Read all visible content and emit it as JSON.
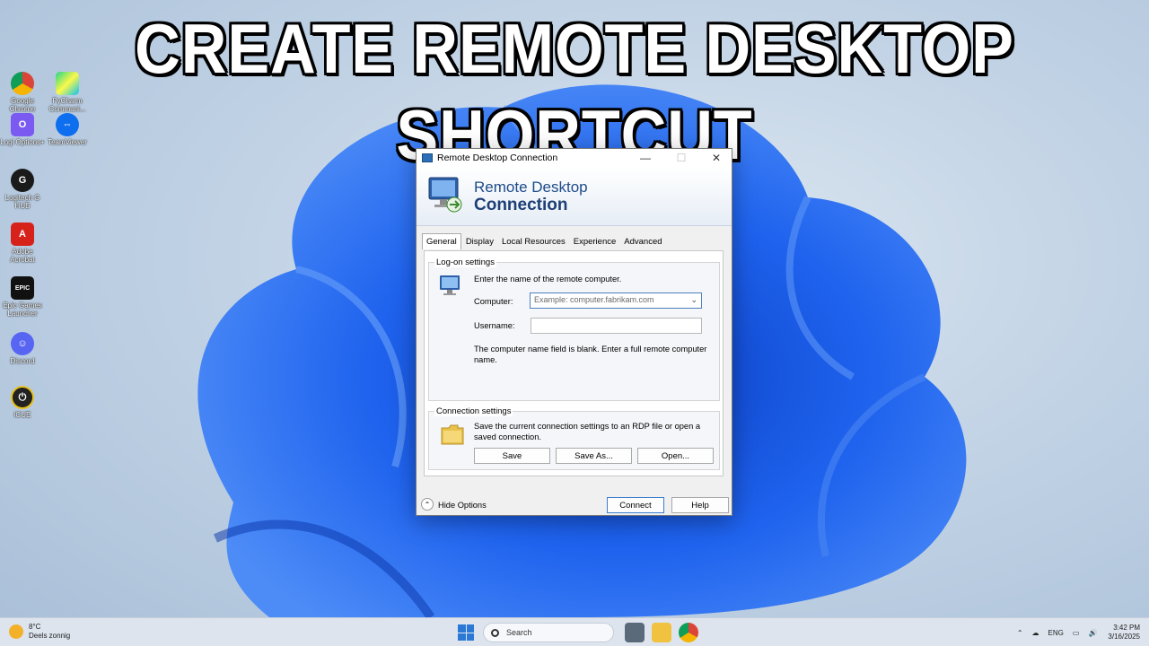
{
  "banner": {
    "title": "CREATE REMOTE DESKTOP SHORTCUT"
  },
  "desktop": {
    "icons": [
      {
        "label": "Google Chrome",
        "icon": "chrome-icon"
      },
      {
        "label": "PyCharm Communi...",
        "icon": "pycharm-icon"
      },
      {
        "label": "Logi Options+",
        "icon": "logi-options-icon"
      },
      {
        "label": "TeamViewer",
        "icon": "teamviewer-icon"
      },
      {
        "label": "Logitech G HUB",
        "icon": "logitech-g-icon"
      },
      {
        "label": "Adobe Acrobat",
        "icon": "acrobat-icon"
      },
      {
        "label": "Epic Games Launcher",
        "icon": "epic-games-icon"
      },
      {
        "label": "Discord",
        "icon": "discord-icon"
      },
      {
        "label": "iCUE",
        "icon": "icue-icon"
      }
    ]
  },
  "window": {
    "title": "Remote Desktop Connection",
    "minimize": "—",
    "maximize": "☐",
    "close": "✕",
    "banner_line1": "Remote Desktop",
    "banner_line2": "Connection",
    "tabs": [
      "General",
      "Display",
      "Local Resources",
      "Experience",
      "Advanced"
    ],
    "logon": {
      "title": "Log-on settings",
      "instruction": "Enter the name of the remote computer.",
      "computer_label": "Computer:",
      "computer_placeholder": "Example: computer.fabrikam.com",
      "username_label": "Username:",
      "username_value": "",
      "blank_msg": "The computer name field is blank. Enter a full remote computer name."
    },
    "connection": {
      "title": "Connection settings",
      "desc": "Save the current connection settings to an RDP file or open a saved connection.",
      "save": "Save",
      "save_as": "Save As...",
      "open": "Open..."
    },
    "hide_options": "Hide Options",
    "connect": "Connect",
    "help": "Help"
  },
  "taskbar": {
    "weather_temp": "8°C",
    "weather_desc": "Deels zonnig",
    "search_placeholder": "Search",
    "language": "ENG",
    "time": "3:42 PM",
    "date": "3/16/2025"
  },
  "colors": {
    "accent_blue": "#1d4b8a",
    "wallpaper_blue": "#1a5fe0"
  }
}
